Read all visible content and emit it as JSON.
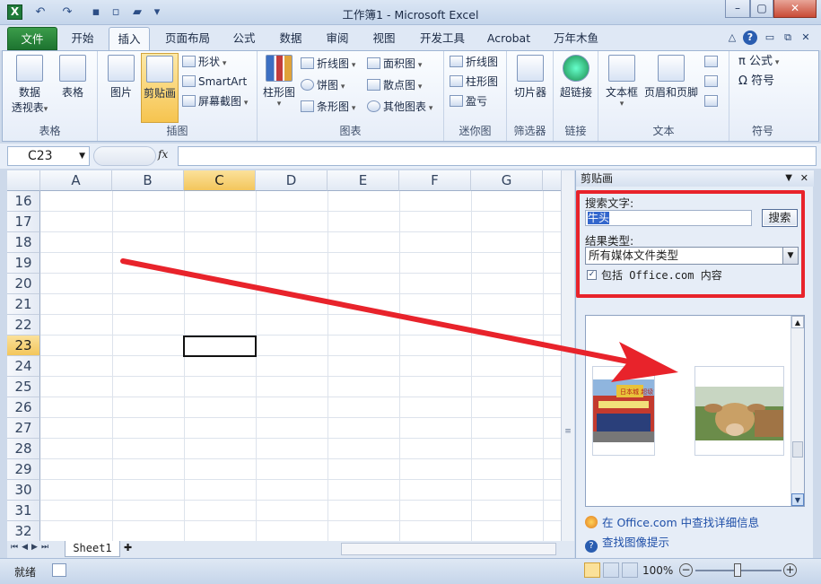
{
  "window": {
    "title": "工作簿1 - Microsoft Excel"
  },
  "tabs": [
    "文件",
    "开始",
    "插入",
    "页面布局",
    "公式",
    "数据",
    "审阅",
    "视图",
    "开发工具",
    "Acrobat",
    "万年木鱼"
  ],
  "ribbon": {
    "groups": {
      "table": "表格",
      "illustrations": "插图",
      "charts": "图表",
      "sparklines": "迷你图",
      "filter": "筛选器",
      "links": "链接",
      "text": "文本",
      "symbols": "符号"
    },
    "buttons": {
      "pivot_line1": "数据",
      "pivot_line2": "透视表",
      "table": "表格",
      "picture": "图片",
      "clipart": "剪贴画",
      "shapes": "形状",
      "smartart": "SmartArt",
      "screenshot": "屏幕截图",
      "column": "柱形图",
      "line": "折线图",
      "pie": "饼图",
      "bar": "条形图",
      "area": "面积图",
      "scatter": "散点图",
      "other": "其他图表",
      "spark_line": "折线图",
      "spark_column": "柱形图",
      "spark_winloss": "盈亏",
      "slicer": "切片器",
      "hyperlink": "超链接",
      "textbox": "文本框",
      "header_footer": "页眉和页脚",
      "equation": "公式",
      "symbol": "符号"
    }
  },
  "formula_bar": {
    "name_box": "C23",
    "fx": "fx",
    "value": ""
  },
  "grid": {
    "columns": [
      "A",
      "B",
      "C",
      "D",
      "E",
      "F",
      "G"
    ],
    "rows": [
      "16",
      "17",
      "18",
      "19",
      "20",
      "21",
      "22",
      "23",
      "24",
      "25",
      "26",
      "27",
      "28",
      "29",
      "30",
      "31",
      "32"
    ],
    "active_column": "C",
    "active_row": "23"
  },
  "sheets": [
    "Sheet1"
  ],
  "status": {
    "ready": "就绪",
    "zoom": "100%"
  },
  "clipart_pane": {
    "title": "剪贴画",
    "search_label": "搜索文字:",
    "search_value": "牛头",
    "search_button": "搜索",
    "type_label": "结果类型:",
    "type_value": "所有媒体文件类型",
    "include_label": "包括 Office.com 内容",
    "link1": "在 Office.com 中查找详细信息",
    "link2": "查找图像提示",
    "results": [
      "日本城 超级市场",
      "cow"
    ]
  },
  "colors": {
    "arrow": "#e8232b",
    "accent_green": "#1d7430",
    "selection": "#f3c65c"
  }
}
